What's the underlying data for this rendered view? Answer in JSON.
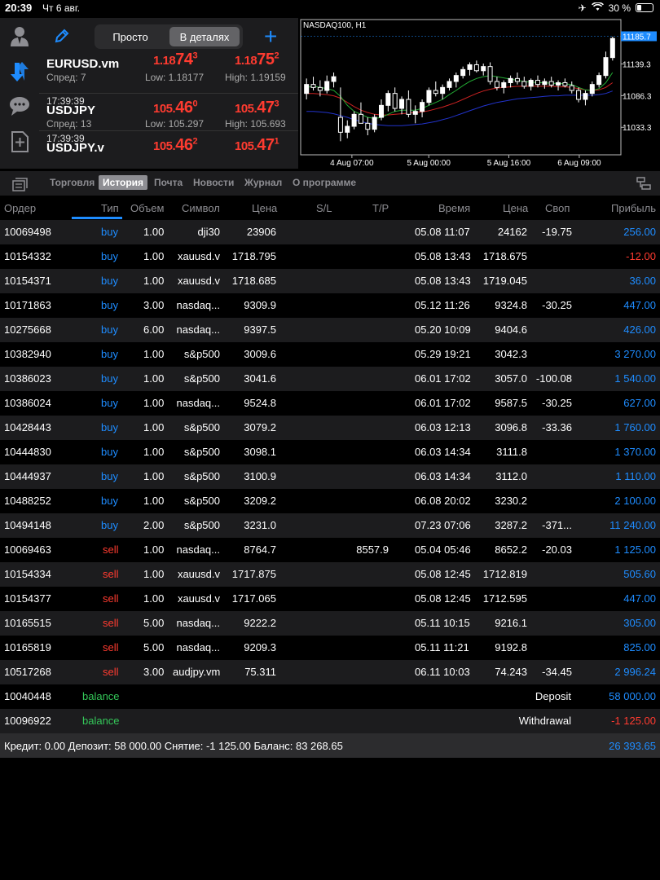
{
  "status": {
    "time": "20:39",
    "date": "Чт 6 авг.",
    "battery": "30 %",
    "battery_level": 0.3
  },
  "toolbar": {
    "simple_label": "Просто",
    "detailed_label": "В деталях",
    "add_label": "+"
  },
  "quotes": [
    {
      "time": "",
      "symbol": "EURUSD.vm",
      "spread": "Спред: 7",
      "bid_main": "1.18",
      "bid_big": "74",
      "bid_sup": "3",
      "ask_main": "1.18",
      "ask_big": "75",
      "ask_sup": "2",
      "low": "Low: 1.18177",
      "high": "High: 1.19159"
    },
    {
      "time": "17:39:39",
      "symbol": "USDJPY",
      "spread": "Спред: 13",
      "bid_main": "105.",
      "bid_big": "46",
      "bid_sup": "0",
      "ask_main": "105.",
      "ask_big": "47",
      "ask_sup": "3",
      "low": "Low: 105.297",
      "high": "High: 105.693"
    },
    {
      "time": "17:39:39",
      "symbol": "USDJPY.v",
      "spread": "",
      "bid_main": "105.",
      "bid_big": "46",
      "bid_sup": "2",
      "ask_main": "105.",
      "ask_big": "47",
      "ask_sup": "1",
      "low": "",
      "high": ""
    }
  ],
  "chart_data": {
    "type": "line",
    "title": "NASDAQ100, H1",
    "current_price": "11185.7",
    "y_ticks": [
      "11139.3",
      "11086.3",
      "11033.3"
    ],
    "x_ticks": [
      "4 Aug 07:00",
      "5 Aug 00:00",
      "5 Aug 16:00",
      "6 Aug 09:00"
    ],
    "ylim": [
      10990,
      11200
    ],
    "candles": [
      [
        11090,
        11115,
        11080,
        11105
      ],
      [
        11105,
        11118,
        11095,
        11100
      ],
      [
        11100,
        11112,
        11085,
        11095
      ],
      [
        11095,
        11120,
        11090,
        11110
      ],
      [
        11110,
        11125,
        11100,
        11118
      ],
      [
        11050,
        11100,
        11010,
        11025
      ],
      [
        11025,
        11045,
        11015,
        11035
      ],
      [
        11035,
        11060,
        11030,
        11055
      ],
      [
        11055,
        11075,
        11045,
        11040
      ],
      [
        11040,
        11050,
        11020,
        11030
      ],
      [
        11030,
        11055,
        11025,
        11050
      ],
      [
        11050,
        11080,
        11045,
        11070
      ],
      [
        11070,
        11095,
        11060,
        11090
      ],
      [
        11090,
        11100,
        11060,
        11065
      ],
      [
        11065,
        11085,
        11055,
        11080
      ],
      [
        11080,
        11095,
        11050,
        11055
      ],
      [
        11055,
        11070,
        11040,
        11060
      ],
      [
        11060,
        11080,
        11050,
        11075
      ],
      [
        11075,
        11100,
        11070,
        11095
      ],
      [
        11095,
        11110,
        11085,
        11090
      ],
      [
        11090,
        11105,
        11080,
        11100
      ],
      [
        11100,
        11115,
        11095,
        11110
      ],
      [
        11110,
        11125,
        11100,
        11120
      ],
      [
        11120,
        11135,
        11115,
        11130
      ],
      [
        11130,
        11142,
        11120,
        11138
      ],
      [
        11138,
        11145,
        11125,
        11128
      ],
      [
        11128,
        11140,
        11120,
        11135
      ],
      [
        11135,
        11142,
        11105,
        11110
      ],
      [
        11110,
        11118,
        11095,
        11100
      ],
      [
        11100,
        11112,
        11090,
        11108
      ],
      [
        11108,
        11120,
        11100,
        11115
      ],
      [
        11115,
        11125,
        11105,
        11110
      ],
      [
        11110,
        11118,
        11098,
        11102
      ],
      [
        11102,
        11115,
        11095,
        11112
      ],
      [
        11112,
        11120,
        11100,
        11105
      ],
      [
        11105,
        11115,
        11098,
        11110
      ],
      [
        11110,
        11118,
        11100,
        11104
      ],
      [
        11104,
        11112,
        11095,
        11108
      ],
      [
        11108,
        11115,
        11100,
        11103
      ],
      [
        11103,
        11110,
        11090,
        11095
      ],
      [
        11095,
        11100,
        11075,
        11080
      ],
      [
        11080,
        11095,
        11070,
        11090
      ],
      [
        11090,
        11110,
        11085,
        11105
      ],
      [
        11105,
        11125,
        11100,
        11120
      ],
      [
        11120,
        11160,
        11115,
        11150
      ],
      [
        11150,
        11185,
        11145,
        11182
      ]
    ],
    "ma_fast": [
      11100,
      11102,
      11100,
      11098,
      11095,
      11085,
      11070,
      11060,
      11055,
      11050,
      11048,
      11050,
      11055,
      11060,
      11062,
      11062,
      11062,
      11065,
      11070,
      11075,
      11080,
      11088,
      11095,
      11103,
      11110,
      11115,
      11118,
      11120,
      11118,
      11116,
      11114,
      11112,
      11110,
      11109,
      11108,
      11108,
      11107,
      11107,
      11106,
      11105,
      11100,
      11096,
      11095,
      11098,
      11108,
      11125
    ],
    "ma_mid": [
      11090,
      11090,
      11089,
      11088,
      11086,
      11082,
      11075,
      11068,
      11062,
      11058,
      11055,
      11054,
      11054,
      11055,
      11056,
      11057,
      11058,
      11059,
      11061,
      11064,
      11067,
      11071,
      11075,
      11080,
      11085,
      11090,
      11094,
      11097,
      11099,
      11100,
      11101,
      11102,
      11102,
      11102,
      11102,
      11102,
      11102,
      11101,
      11101,
      11100,
      11098,
      11096,
      11095,
      11096,
      11100,
      11108
    ],
    "ma_slow": [
      11060,
      11060,
      11059,
      11058,
      11056,
      11053,
      11050,
      11046,
      11043,
      11040,
      11038,
      11037,
      11036,
      11036,
      11036,
      11037,
      11038,
      11039,
      11041,
      11043,
      11046,
      11049,
      11053,
      11057,
      11061,
      11065,
      11069,
      11072,
      11075,
      11077,
      11079,
      11081,
      11082,
      11083,
      11084,
      11085,
      11086,
      11086,
      11087,
      11087,
      11087,
      11087,
      11087,
      11088,
      11090,
      11094
    ]
  },
  "tabs": [
    "Торговля",
    "История",
    "Почта",
    "Новости",
    "Журнал",
    "О программе"
  ],
  "active_tab": 1,
  "columns": [
    "Ордер",
    "Тип",
    "Объем",
    "Символ",
    "Цена",
    "S/L",
    "T/P",
    "Время",
    "Цена",
    "Своп",
    "Прибыль"
  ],
  "rows": [
    {
      "order": "10069498",
      "type": "buy",
      "volume": "1.00",
      "symbol": "dji30",
      "price": "23906",
      "sl": "",
      "tp": "",
      "time": "05.08 11:07",
      "close": "24162",
      "swap": "-19.75",
      "profit": "256.00",
      "ptype": "pos"
    },
    {
      "order": "10154332",
      "type": "buy",
      "volume": "1.00",
      "symbol": "xauusd.v",
      "price": "1718.795",
      "sl": "",
      "tp": "",
      "time": "05.08 13:43",
      "close": "1718.675",
      "swap": "",
      "profit": "-12.00",
      "ptype": "neg"
    },
    {
      "order": "10154371",
      "type": "buy",
      "volume": "1.00",
      "symbol": "xauusd.v",
      "price": "1718.685",
      "sl": "",
      "tp": "",
      "time": "05.08 13:43",
      "close": "1719.045",
      "swap": "",
      "profit": "36.00",
      "ptype": "pos"
    },
    {
      "order": "10171863",
      "type": "buy",
      "volume": "3.00",
      "symbol": "nasdaq...",
      "price": "9309.9",
      "sl": "",
      "tp": "",
      "time": "05.12 11:26",
      "close": "9324.8",
      "swap": "-30.25",
      "profit": "447.00",
      "ptype": "pos"
    },
    {
      "order": "10275668",
      "type": "buy",
      "volume": "6.00",
      "symbol": "nasdaq...",
      "price": "9397.5",
      "sl": "",
      "tp": "",
      "time": "05.20 10:09",
      "close": "9404.6",
      "swap": "",
      "profit": "426.00",
      "ptype": "pos"
    },
    {
      "order": "10382940",
      "type": "buy",
      "volume": "1.00",
      "symbol": "s&p500",
      "price": "3009.6",
      "sl": "",
      "tp": "",
      "time": "05.29 19:21",
      "close": "3042.3",
      "swap": "",
      "profit": "3 270.00",
      "ptype": "pos"
    },
    {
      "order": "10386023",
      "type": "buy",
      "volume": "1.00",
      "symbol": "s&p500",
      "price": "3041.6",
      "sl": "",
      "tp": "",
      "time": "06.01 17:02",
      "close": "3057.0",
      "swap": "-100.08",
      "profit": "1 540.00",
      "ptype": "pos"
    },
    {
      "order": "10386024",
      "type": "buy",
      "volume": "1.00",
      "symbol": "nasdaq...",
      "price": "9524.8",
      "sl": "",
      "tp": "",
      "time": "06.01 17:02",
      "close": "9587.5",
      "swap": "-30.25",
      "profit": "627.00",
      "ptype": "pos"
    },
    {
      "order": "10428443",
      "type": "buy",
      "volume": "1.00",
      "symbol": "s&p500",
      "price": "3079.2",
      "sl": "",
      "tp": "",
      "time": "06.03 12:13",
      "close": "3096.8",
      "swap": "-33.36",
      "profit": "1 760.00",
      "ptype": "pos"
    },
    {
      "order": "10444830",
      "type": "buy",
      "volume": "1.00",
      "symbol": "s&p500",
      "price": "3098.1",
      "sl": "",
      "tp": "",
      "time": "06.03 14:34",
      "close": "3111.8",
      "swap": "",
      "profit": "1 370.00",
      "ptype": "pos"
    },
    {
      "order": "10444937",
      "type": "buy",
      "volume": "1.00",
      "symbol": "s&p500",
      "price": "3100.9",
      "sl": "",
      "tp": "",
      "time": "06.03 14:34",
      "close": "3112.0",
      "swap": "",
      "profit": "1 110.00",
      "ptype": "pos"
    },
    {
      "order": "10488252",
      "type": "buy",
      "volume": "1.00",
      "symbol": "s&p500",
      "price": "3209.2",
      "sl": "",
      "tp": "",
      "time": "06.08 20:02",
      "close": "3230.2",
      "swap": "",
      "profit": "2 100.00",
      "ptype": "pos"
    },
    {
      "order": "10494148",
      "type": "buy",
      "volume": "2.00",
      "symbol": "s&p500",
      "price": "3231.0",
      "sl": "",
      "tp": "",
      "time": "07.23 07:06",
      "close": "3287.2",
      "swap": "-371...",
      "profit": "11 240.00",
      "ptype": "pos"
    },
    {
      "order": "10069463",
      "type": "sell",
      "volume": "1.00",
      "symbol": "nasdaq...",
      "price": "8764.7",
      "sl": "",
      "tp": "8557.9",
      "time": "05.04 05:46",
      "close": "8652.2",
      "swap": "-20.03",
      "profit": "1 125.00",
      "ptype": "pos"
    },
    {
      "order": "10154334",
      "type": "sell",
      "volume": "1.00",
      "symbol": "xauusd.v",
      "price": "1717.875",
      "sl": "",
      "tp": "",
      "time": "05.08 12:45",
      "close": "1712.819",
      "swap": "",
      "profit": "505.60",
      "ptype": "pos"
    },
    {
      "order": "10154377",
      "type": "sell",
      "volume": "1.00",
      "symbol": "xauusd.v",
      "price": "1717.065",
      "sl": "",
      "tp": "",
      "time": "05.08 12:45",
      "close": "1712.595",
      "swap": "",
      "profit": "447.00",
      "ptype": "pos"
    },
    {
      "order": "10165515",
      "type": "sell",
      "volume": "5.00",
      "symbol": "nasdaq...",
      "price": "9222.2",
      "sl": "",
      "tp": "",
      "time": "05.11 10:15",
      "close": "9216.1",
      "swap": "",
      "profit": "305.00",
      "ptype": "pos"
    },
    {
      "order": "10165819",
      "type": "sell",
      "volume": "5.00",
      "symbol": "nasdaq...",
      "price": "9209.3",
      "sl": "",
      "tp": "",
      "time": "05.11 11:21",
      "close": "9192.8",
      "swap": "",
      "profit": "825.00",
      "ptype": "pos"
    },
    {
      "order": "10517268",
      "type": "sell",
      "volume": "3.00",
      "symbol": "audjpy.vm",
      "price": "75.311",
      "sl": "",
      "tp": "",
      "time": "06.11 10:03",
      "close": "74.243",
      "swap": "-34.45",
      "profit": "2 996.24",
      "ptype": "pos"
    },
    {
      "order": "10040448",
      "type": "balance",
      "volume": "",
      "symbol": "",
      "price": "",
      "sl": "",
      "tp": "",
      "time": "",
      "close": "",
      "swap": "",
      "comment": "Deposit",
      "profit": "58 000.00",
      "ptype": "pos"
    },
    {
      "order": "10096922",
      "type": "balance",
      "volume": "",
      "symbol": "",
      "price": "",
      "sl": "",
      "tp": "",
      "time": "",
      "close": "",
      "swap": "",
      "comment": "Withdrawal",
      "profit": "-1 125.00",
      "ptype": "neg"
    }
  ],
  "footer": {
    "summary": "Кредит: 0.00 Депозит: 58 000.00 Снятие: -1 125.00 Баланс: 83 268.65",
    "total": "26 393.65"
  },
  "colors": {
    "accent": "#1e8cff",
    "sell": "#ff3b30",
    "balance": "#34c759",
    "panel": "#1c1c1e"
  }
}
